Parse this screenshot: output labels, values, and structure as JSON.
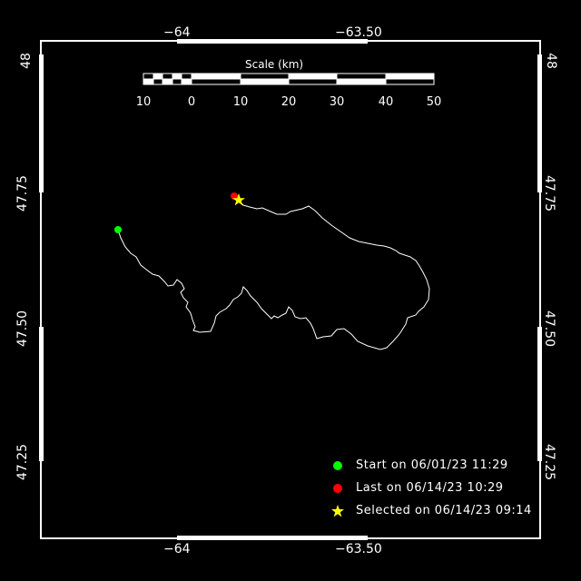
{
  "map": {
    "axes": {
      "top_ticks": [
        "−64",
        "−63.50"
      ],
      "bottom_ticks": [
        "−64",
        "−63.50"
      ],
      "left_ticks": [
        "48",
        "47.75",
        "47.50",
        "47.25"
      ],
      "right_ticks": [
        "48",
        "47.75",
        "47.50",
        "47.25"
      ]
    },
    "scale_bar": {
      "title": "Scale (km)",
      "ticks": [
        "10",
        "0",
        "10",
        "20",
        "30",
        "40",
        "50"
      ]
    },
    "legend": [
      {
        "label": "Start on 06/01/23 11:29",
        "color": "#00ff00",
        "icon": "circle-icon"
      },
      {
        "label": "Last on 06/14/23 10:29",
        "color": "#ff0000",
        "icon": "circle-icon"
      },
      {
        "label": "Selected on 06/14/23 09:14",
        "color": "#ffff00",
        "icon": "star-icon"
      }
    ],
    "track_color": "#ffffff",
    "frame_color": "#ffffff"
  }
}
